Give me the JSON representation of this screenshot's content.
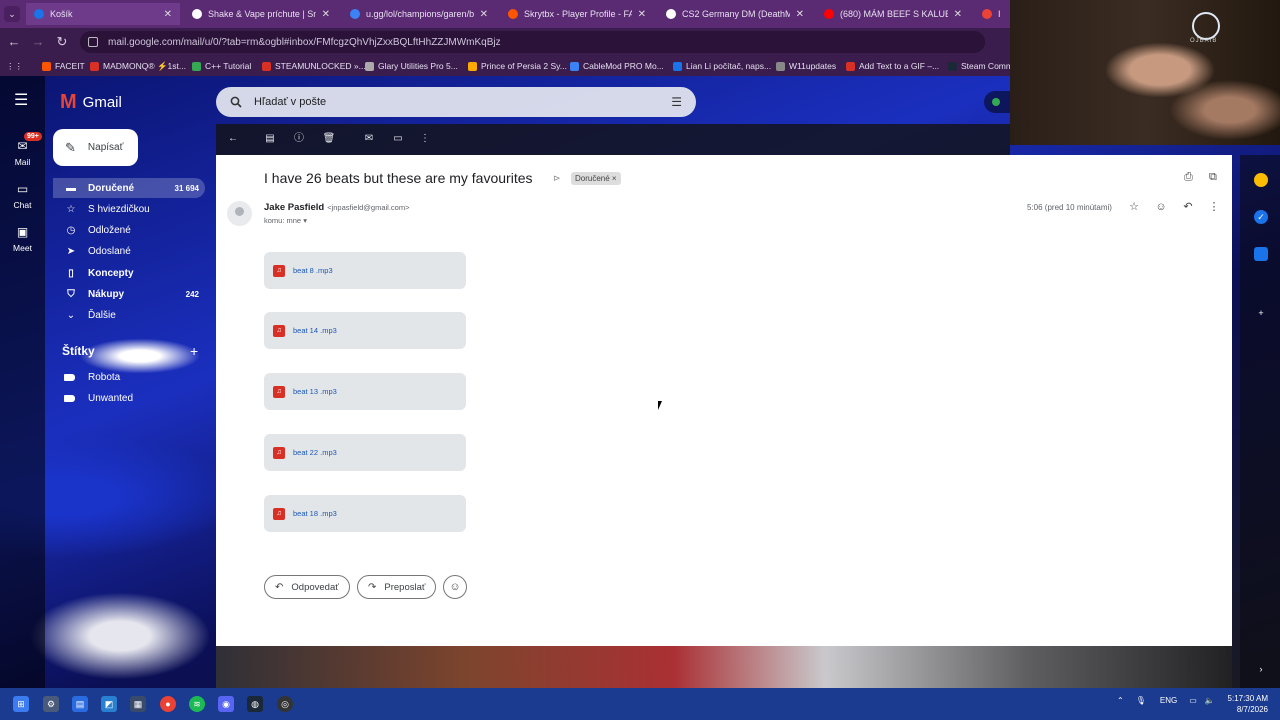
{
  "browser": {
    "tabs": [
      {
        "title": "Košík",
        "color": "#1a73e8"
      },
      {
        "title": "Shake & Vape príchute | Snade",
        "color": "#ffffff"
      },
      {
        "title": "u.gg/lol/champions/garen/bu",
        "color": "#3b82f6"
      },
      {
        "title": "Skrytbx - Player Profile - FACEIT",
        "color": "#ff5500"
      },
      {
        "title": "CS2 Germany DM (DeathMatch)",
        "color": "#ffffff"
      },
      {
        "title": "(680) MÁM BEEF S KALUBOU",
        "color": "#ff0000"
      },
      {
        "title": "I ha",
        "color": "#ea4335"
      }
    ],
    "url": "mail.google.com/mail/u/0/?tab=rm&ogbl#inbox/FMfcgzQhVhjZxxBQLftHhZZJMWmKqBjz",
    "bookmarks": [
      {
        "label": "FACEIT",
        "color": "#ff5500"
      },
      {
        "label": "MADMONQ® ⚡1st...",
        "color": "#d93025"
      },
      {
        "label": "C++ Tutorial",
        "color": "#34a853"
      },
      {
        "label": "STEAMUNLOCKED »...",
        "color": "#d93025"
      },
      {
        "label": "Glary Utilities Pro 5...",
        "color": "#aaaaaa"
      },
      {
        "label": "Prince of Persia 2 Sy...",
        "color": "#ffaa00"
      },
      {
        "label": "CableMod PRO Mo...",
        "color": "#3b82f6"
      },
      {
        "label": "Lian Li počítač, naps...",
        "color": "#1a73e8"
      },
      {
        "label": "W11updates",
        "color": "#888888"
      },
      {
        "label": "Add Text to a GIF –...",
        "color": "#d93025"
      },
      {
        "label": "Steam Comm",
        "color": "#1b2838"
      }
    ]
  },
  "gmail": {
    "logo_text": "Gmail",
    "search_placeholder": "Hľadať v pošte",
    "rail": {
      "mail_label": "Mail",
      "mail_badge": "99+",
      "chat_label": "Chat",
      "meet_label": "Meet"
    },
    "compose_label": "Napísať",
    "nav": [
      {
        "label": "Doručené",
        "count": "31 694",
        "icon": "inbox-icon"
      },
      {
        "label": "S hviezdičkou",
        "count": "",
        "icon": "star-icon"
      },
      {
        "label": "Odložené",
        "count": "",
        "icon": "clock-icon"
      },
      {
        "label": "Odoslané",
        "count": "",
        "icon": "send-icon"
      },
      {
        "label": "Koncepty",
        "count": "",
        "icon": "draft-icon"
      },
      {
        "label": "Nákupy",
        "count": "242",
        "icon": "shopping-icon"
      },
      {
        "label": "Ďalšie",
        "count": "",
        "icon": "chevron-down-icon"
      }
    ],
    "labels_heading": "Štítky",
    "labels": [
      "Robota",
      "Unwanted"
    ]
  },
  "message": {
    "subject": "I have 26 beats but these are my favourites",
    "label_chip": "Doručené",
    "sender_name": "Jake Pasfield",
    "sender_email": "<jnpasfield@gmail.com>",
    "to_line": "komu: mne",
    "time": "5:06 (pred 10 minútami)",
    "attachments": [
      "beat 8 .mp3",
      "beat 14 .mp3",
      "beat 13 .mp3",
      "beat 22 .mp3",
      "beat 18 .mp3"
    ],
    "reply_label": "Odpovedať",
    "forward_label": "Preposlať"
  },
  "webcam": {
    "logo_text": "OJBAIB"
  },
  "taskbar": {
    "lang": "ENG",
    "time": "5:17:30 AM",
    "date": "8/7/2026"
  }
}
